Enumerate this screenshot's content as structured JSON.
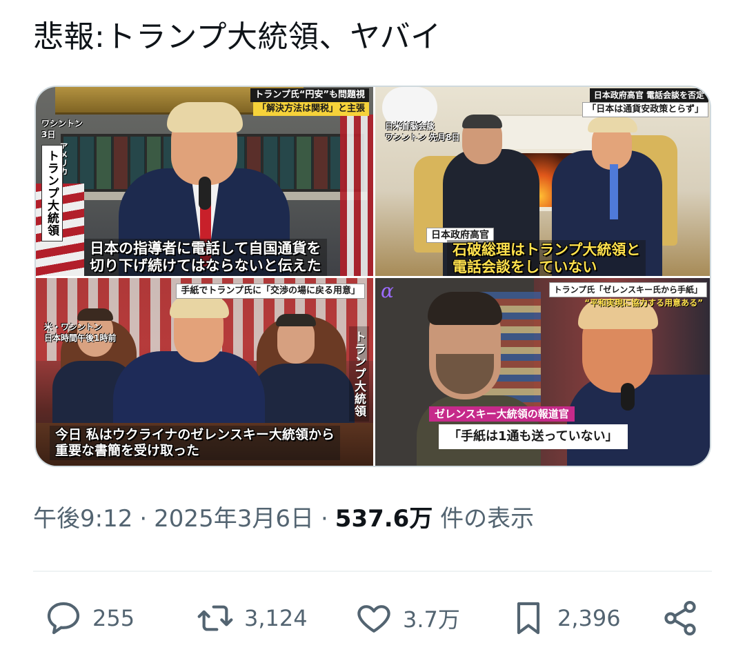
{
  "tweet": {
    "text": "悲報:トランプ大統領、ヤバイ",
    "time": "午後9:12",
    "date": "2025年3月6日",
    "views_count": "537.6万",
    "views_label": "件の表示",
    "separator": "·"
  },
  "media": [
    {
      "top_banner_1": "トランプ氏“円安”も問題視",
      "top_banner_2": "「解決方法は関税」と主張",
      "location_1": "ワシントン",
      "location_2": "3日",
      "location_3": "アメリカ",
      "vertical_label": "トランプ大統領",
      "caption_line1": "日本の指導者に電話して自国通貨を",
      "caption_line2": "切り下げ続けてはならないと伝えた"
    },
    {
      "top_banner_1": "日本政府高官 電話会談を否定",
      "top_banner_2": "「日本は通貨安政策とらず」",
      "location_1": "日米首脳会談",
      "location_2": "ワシントン 先月8日",
      "speaker_label": "日本政府高官",
      "caption_line1": "石破総理はトランプ大統領と",
      "caption_line2": "電話会談をしていない"
    },
    {
      "top_banner": "手紙でトランプ氏に「交渉の場に戻る用意」",
      "location_1": "米・ワシントン",
      "location_2": "日本時間午後1時前",
      "vertical_label": "トランプ大統領",
      "caption_line1": "今日 私はウクライナのゼレンスキー大統領から",
      "caption_line2": "重要な書簡を受け取った"
    },
    {
      "logo": "α",
      "top_banner_1": "トランプ氏「ゼレンスキー氏から手紙」",
      "top_banner_2": "“平和実現に協力する用意ある”",
      "speaker_label": "ゼレンスキー大統領の報道官",
      "quote": "「手紙は1通も送っていない」"
    }
  ],
  "actions": {
    "replies": "255",
    "reposts": "3,124",
    "likes": "3.7万",
    "bookmarks": "2,396"
  },
  "colors": {
    "text_primary": "#0f1419",
    "text_secondary": "#536471",
    "border": "#cfd9de"
  }
}
